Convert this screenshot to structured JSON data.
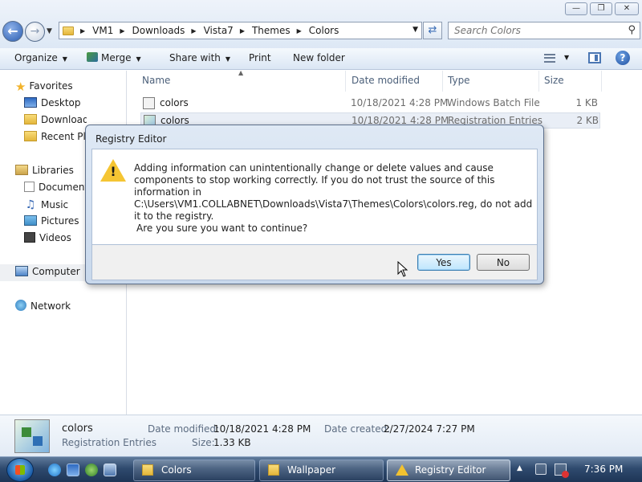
{
  "address_bar": {
    "path": [
      "VM1",
      "Downloads",
      "Vista7",
      "Themes",
      "Colors"
    ]
  },
  "search": {
    "placeholder": "Search Colors"
  },
  "toolbar": {
    "organize": "Organize",
    "merge": "Merge",
    "share_with": "Share with",
    "print": "Print",
    "new_folder": "New folder"
  },
  "nav": {
    "favorites": "Favorites",
    "desktop": "Desktop",
    "downloads": "Downloads",
    "recent_places": "Recent Places",
    "libraries": "Libraries",
    "documents": "Documents",
    "music": "Music",
    "pictures": "Pictures",
    "videos": "Videos",
    "computer": "Computer",
    "network": "Network"
  },
  "columns": {
    "name": "Name",
    "date_modified": "Date modified",
    "type": "Type",
    "size": "Size"
  },
  "files": [
    {
      "name": "colors",
      "date": "10/18/2021 4:28 PM",
      "type": "Windows Batch File",
      "size": "1 KB"
    },
    {
      "name": "colors",
      "date": "10/18/2021 4:28 PM",
      "type": "Registration Entries",
      "size": "2 KB"
    }
  ],
  "details": {
    "name": "colors",
    "type": "Registration Entries",
    "date_modified_label": "Date modified:",
    "date_modified": "10/18/2021 4:28 PM",
    "size_label": "Size:",
    "size": "1.33 KB",
    "date_created_label": "Date created:",
    "date_created": "2/27/2024 7:27 PM"
  },
  "dialog": {
    "title": "Registry Editor",
    "message": "Adding information can unintentionally change or delete values and cause components to stop working correctly. If you do not trust the source of this information in C:\\Users\\VM1.COLLABNET\\Downloads\\Vista7\\Themes\\Colors\\colors.reg, do not add it to the registry.",
    "question": "Are you sure you want to continue?",
    "yes": "Yes",
    "no": "No"
  },
  "taskbar": {
    "buttons": [
      {
        "label": "Colors"
      },
      {
        "label": "Wallpaper"
      },
      {
        "label": "Registry Editor"
      }
    ],
    "clock": "7:36 PM"
  }
}
